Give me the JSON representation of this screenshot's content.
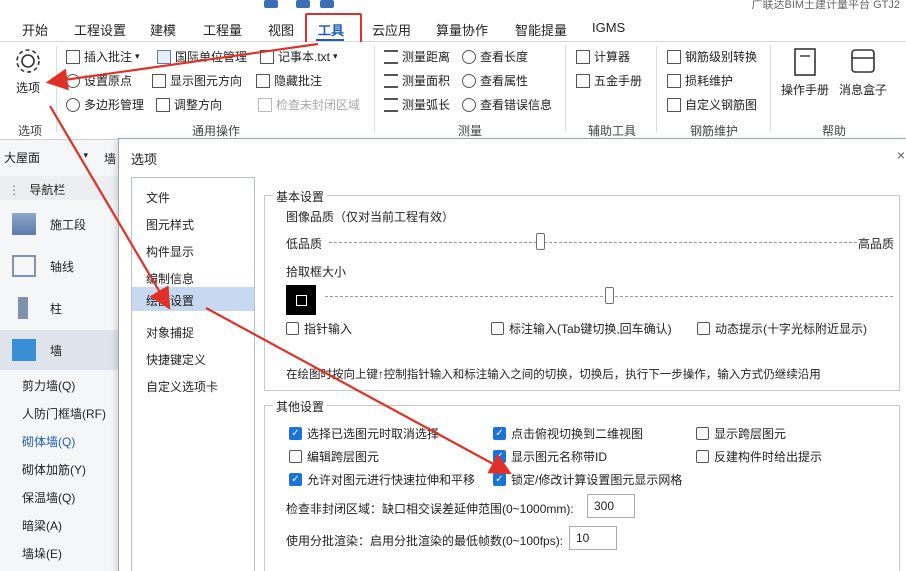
{
  "title_bar": {
    "text": "广联达BIM土建计量平台 GTJ2"
  },
  "menu": {
    "items": [
      "开始",
      "工程设置",
      "建模",
      "工程量",
      "视图",
      "工具",
      "云应用",
      "算量协作",
      "智能提量",
      "IGMS"
    ],
    "active": "工具"
  },
  "ribbon": {
    "options_group": {
      "button": "选项",
      "label": "选项"
    },
    "general_ops": {
      "label": "通用操作",
      "insert_comment": "插入批注",
      "unit_convert": "国际单位管理",
      "notepad": "记事本.txt",
      "set_origin": "设置原点",
      "show_direction": "显示图元方向",
      "hide_comment": "隐藏批注",
      "polygon_manage": "多边形管理",
      "adjust_direction": "调整方向",
      "check_unclosed": "检查未封闭区域"
    },
    "measure": {
      "label": "测量",
      "distance": "测量距离",
      "length": "查看长度",
      "area": "测量面积",
      "property": "查看属性",
      "arc": "测量弧长",
      "error_info": "查看错误信息"
    },
    "aux": {
      "label": "辅助工具",
      "calculator": "计算器",
      "manual": "五金手册"
    },
    "rebar": {
      "label": "钢筋维护",
      "grade_convert": "钢筋级别转换",
      "loss": "损耗维护",
      "custom": "自定义钢筋图"
    },
    "help": {
      "label": "帮助",
      "manual": "操作手册",
      "msgbox": "消息盒子"
    }
  },
  "left_panel": {
    "floor": "大屋面",
    "navbar": "导航栏",
    "nav_items": [
      "施工段",
      "轴线",
      "柱",
      "墙"
    ],
    "selected_nav": "墙",
    "sub_items": [
      "剪力墙(Q)",
      "人防门框墙(RF)",
      "砌体墙(Q)",
      "砌体加筋(Y)",
      "保温墙(Q)",
      "暗梁(A)",
      "墙垛(E)"
    ],
    "selected_sub": "砌体墙(Q)"
  },
  "dialog": {
    "title": "选项",
    "close": "×",
    "categories": [
      "文件",
      "图元样式",
      "构件显示",
      "编制信息",
      "绘图设置",
      "对象捕捉",
      "快捷键定义",
      "自定义选项卡"
    ],
    "selected_category": "绘图设置",
    "basic": {
      "legend": "基本设置",
      "image_quality": "图像品质（仅对当前工程有效）",
      "low": "低品质",
      "high": "高品质",
      "quality_level": 0.4,
      "pick_size": "拾取框大小",
      "pick_level": 0.5,
      "pointer_input": {
        "label": "指针输入",
        "checked": false
      },
      "dim_input": {
        "label": "标注输入(Tab键切换,回车确认)",
        "checked": false
      },
      "dynamic_hint": {
        "label": "动态提示(十字光标附近显示)",
        "checked": false
      },
      "note": "在绘图时按向上键↑控制指针输入和标注输入之间的切换，切换后，执行下一步操作，输入方式仍继续沿用"
    },
    "other": {
      "legend": "其他设置",
      "cb1": {
        "label": "选择已选图元时取消选择",
        "checked": true
      },
      "cb2": {
        "label": "点击俯视切换到二维视图",
        "checked": true
      },
      "cb3": {
        "label": "显示跨层图元",
        "checked": false
      },
      "cb4": {
        "label": "编辑跨层图元",
        "checked": false
      },
      "cb5": {
        "label": "显示图元名称带ID",
        "checked": true
      },
      "cb6": {
        "label": "反建构件时给出提示",
        "checked": false
      },
      "cb7": {
        "label": "允许对图元进行快速拉伸和平移",
        "checked": true
      },
      "cb8": {
        "label": "锁定/修改计算设置图元显示网格",
        "checked": true
      },
      "check_label": "检查非封闭区域：缺口相交误差延伸范围(0~1000mm):",
      "check_value": "300",
      "batch_label": "使用分批渲染：启用分批渲染的最低帧数(0~100fps):",
      "batch_value": "10"
    }
  },
  "colors": {
    "accent": "#1e5fb4",
    "annotation_red": "#e03128",
    "checkbox_blue": "#1a73d9"
  }
}
